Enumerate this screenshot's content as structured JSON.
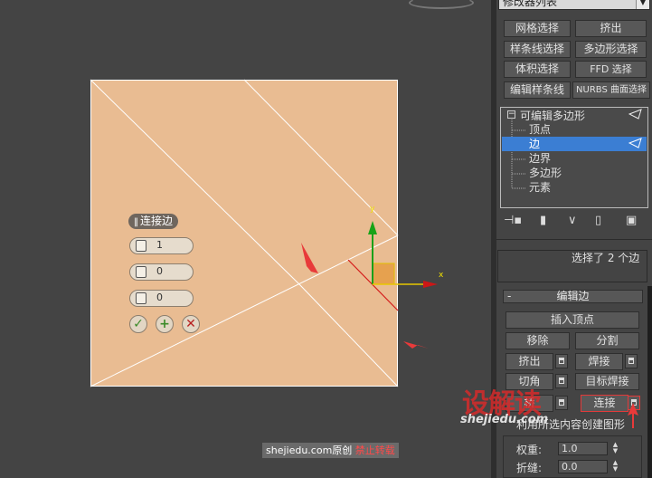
{
  "modifier_list": {
    "label": "修改器列表"
  },
  "modifier_buttons": [
    {
      "label": "网格选择"
    },
    {
      "label": "挤出"
    },
    {
      "label": "样条线选择"
    },
    {
      "label": "多边形选择"
    },
    {
      "label": "体积选择"
    },
    {
      "label": "FFD 选择"
    },
    {
      "label": "编辑样条线"
    },
    {
      "label": "NURBS 曲面选择"
    }
  ],
  "stack": {
    "root": "可编辑多边形",
    "items": [
      "顶点",
      "边",
      "边界",
      "多边形",
      "元素"
    ],
    "selected_index": 1
  },
  "status": {
    "text": "选择了 2 个边"
  },
  "rollout": {
    "title": "编辑边",
    "collapse": "-",
    "insert_vertex": "插入顶点",
    "remove": "移除",
    "split": "分割",
    "extrude": "挤出",
    "weld": "焊接",
    "chamfer": "切角",
    "target_weld": "目标焊接",
    "bridge_partial": "桥",
    "connect": "连接",
    "create_shape": "利用所选内容创建图形",
    "weight_label": "权重:",
    "weight_value": "1.0",
    "crease_label": "折缝:",
    "crease_value": "0.0"
  },
  "caddy": {
    "title": "连接边",
    "segments": "1",
    "pinch": "0",
    "slide": "0",
    "ok_icon": "✓",
    "apply_icon": "+",
    "cancel_icon": "✕"
  },
  "gizmo": {
    "y_label": "y",
    "x_label": "x"
  },
  "watermark": {
    "logo_text": "设解读",
    "logo_url": "shejiedu.com",
    "credit_site": "shejiedu.com原创",
    "credit_note": "禁止转载"
  },
  "colors": {
    "plane": "#e9bc92",
    "selection": "#3b7ed3",
    "annotation": "#e83a3a",
    "watermark": "#d62b2b"
  }
}
